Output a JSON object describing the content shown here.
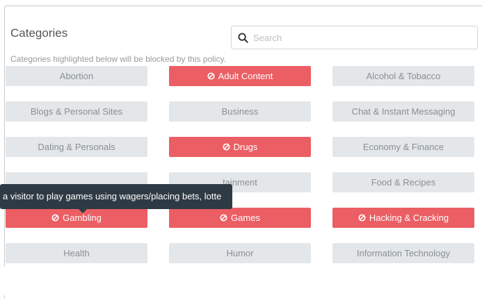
{
  "panel": {
    "title": "Categories",
    "subtitle": "Categories highlighted below will be blocked by this policy."
  },
  "search": {
    "placeholder": "Search",
    "value": ""
  },
  "tooltip": {
    "text": "a visitor to play games using wagers/placing bets, lotte"
  },
  "colors": {
    "blocked": "#eb5e64",
    "allowed": "#e3e7ea",
    "tooltip": "#2f3b44"
  },
  "categories": [
    {
      "label": "Abortion",
      "blocked": false
    },
    {
      "label": "Adult Content",
      "blocked": true
    },
    {
      "label": "Alcohol & Tobacco",
      "blocked": false
    },
    {
      "label": "Blogs & Personal Sites",
      "blocked": false
    },
    {
      "label": "Business",
      "blocked": false
    },
    {
      "label": "Chat & Instant Messaging",
      "blocked": false
    },
    {
      "label": "Dating & Personals",
      "blocked": false
    },
    {
      "label": "Drugs",
      "blocked": true
    },
    {
      "label": "Economy & Finance",
      "blocked": false
    },
    {
      "label": "",
      "blocked": false
    },
    {
      "label": "tainment",
      "blocked": false
    },
    {
      "label": "Food & Recipes",
      "blocked": false
    },
    {
      "label": "Gambling",
      "blocked": true
    },
    {
      "label": "Games",
      "blocked": true
    },
    {
      "label": "Hacking & Cracking",
      "blocked": true
    },
    {
      "label": "Health",
      "blocked": false
    },
    {
      "label": "Humor",
      "blocked": false
    },
    {
      "label": "Information Technology",
      "blocked": false
    }
  ]
}
